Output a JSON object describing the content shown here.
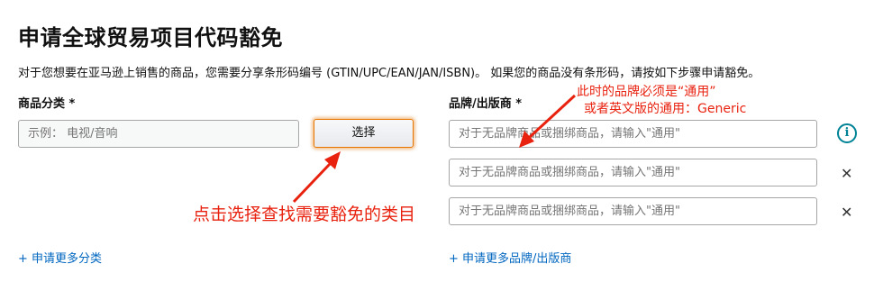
{
  "page": {
    "title": "申请全球贸易项目代码豁免",
    "description": "对于您想要在亚马逊上销售的商品，您需要分享条形码编号 (GTIN/UPC/EAN/JAN/ISBN)。 如果您的商品没有条形码，请按如下步骤申请豁免。"
  },
  "category": {
    "label": "商品分类 *",
    "placeholder": "示例： 电视/音响",
    "select_button": "选择",
    "add_more": "+ 申请更多分类"
  },
  "brand": {
    "label": "品牌/出版商 *",
    "fields": [
      {
        "placeholder": "对于无品牌商品或捆绑商品，请输入\"通用\""
      },
      {
        "placeholder": "对于无品牌商品或捆绑商品，请输入\"通用\""
      },
      {
        "placeholder": "对于无品牌商品或捆绑商品，请输入\"通用\""
      }
    ],
    "add_more": "+ 申请更多品牌/出版商"
  },
  "icons": {
    "info": "i",
    "close": "✕"
  },
  "annotations": {
    "brand_note_line1": "此时的品牌必须是“通用”",
    "brand_note_line2": "或者英文版的通用：Generic",
    "category_note": "点击选择查找需要豁免的类目",
    "color": "#e8220f"
  }
}
